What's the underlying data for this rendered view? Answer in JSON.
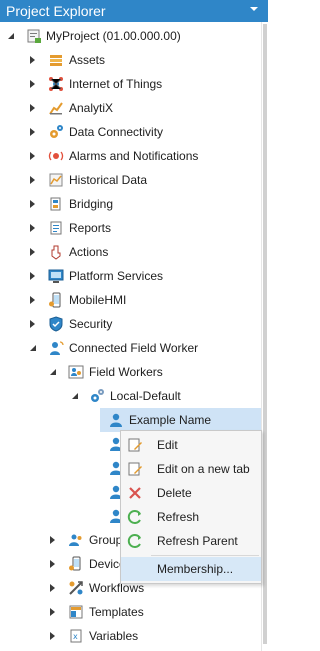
{
  "panel": {
    "title": "Project Explorer"
  },
  "tree": {
    "root": "MyProject (01.00.000.00)",
    "items": [
      "Assets",
      "Internet of Things",
      "AnalytiX",
      "Data Connectivity",
      "Alarms and Notifications",
      "Historical Data",
      "Bridging",
      "Reports",
      "Actions",
      "Platform Services",
      "MobileHMI",
      "Security",
      "Connected Field Worker"
    ],
    "field_workers": "Field Workers",
    "local_default": "Local-Default",
    "example_name": "Example Name",
    "groups_partial": "Group",
    "devices_partial": "Device",
    "workflows": "Workflows",
    "templates": "Templates",
    "variables": "Variables"
  },
  "context_menu": {
    "edit": "Edit",
    "edit_new_tab": "Edit on a new tab",
    "delete": "Delete",
    "refresh": "Refresh",
    "refresh_parent": "Refresh Parent",
    "membership": "Membership..."
  },
  "colors": {
    "title_bar": "#2f86c8",
    "selection": "#cfe3f6",
    "menu_hover": "#d7e8f7"
  }
}
